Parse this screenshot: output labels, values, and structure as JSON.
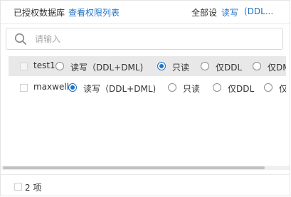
{
  "header": {
    "title": "已授权数据库",
    "view_link": "查看权限列表",
    "set_all": "全部设",
    "set_read_write": "读写",
    "set_ddl": "(DDL..."
  },
  "search": {
    "placeholder": "请输入",
    "value": ""
  },
  "databases": [
    {
      "name": "test1",
      "selected_permission": "只读",
      "options": [
        "读写（DDL+DML)",
        "只读",
        "仅DDL",
        "仅DML"
      ],
      "option_display": [
        "读写（DDL+DML)",
        "只读",
        "仅DDL",
        "仅DM"
      ]
    },
    {
      "name": "maxwell",
      "selected_permission": "读写（DDL+DML)",
      "options": [
        "读写（DDL+DML)",
        "只读",
        "仅DDL",
        "仅DML"
      ],
      "option_display": [
        "读写（DDL+DML)",
        "只读",
        "仅DDL",
        "仅"
      ]
    }
  ],
  "footer": {
    "count_label": "2 项"
  },
  "colors": {
    "accent": "#1d72c7",
    "row_highlight": "#e8e8e8",
    "text": "#333333",
    "placeholder": "#a6a6a6"
  }
}
